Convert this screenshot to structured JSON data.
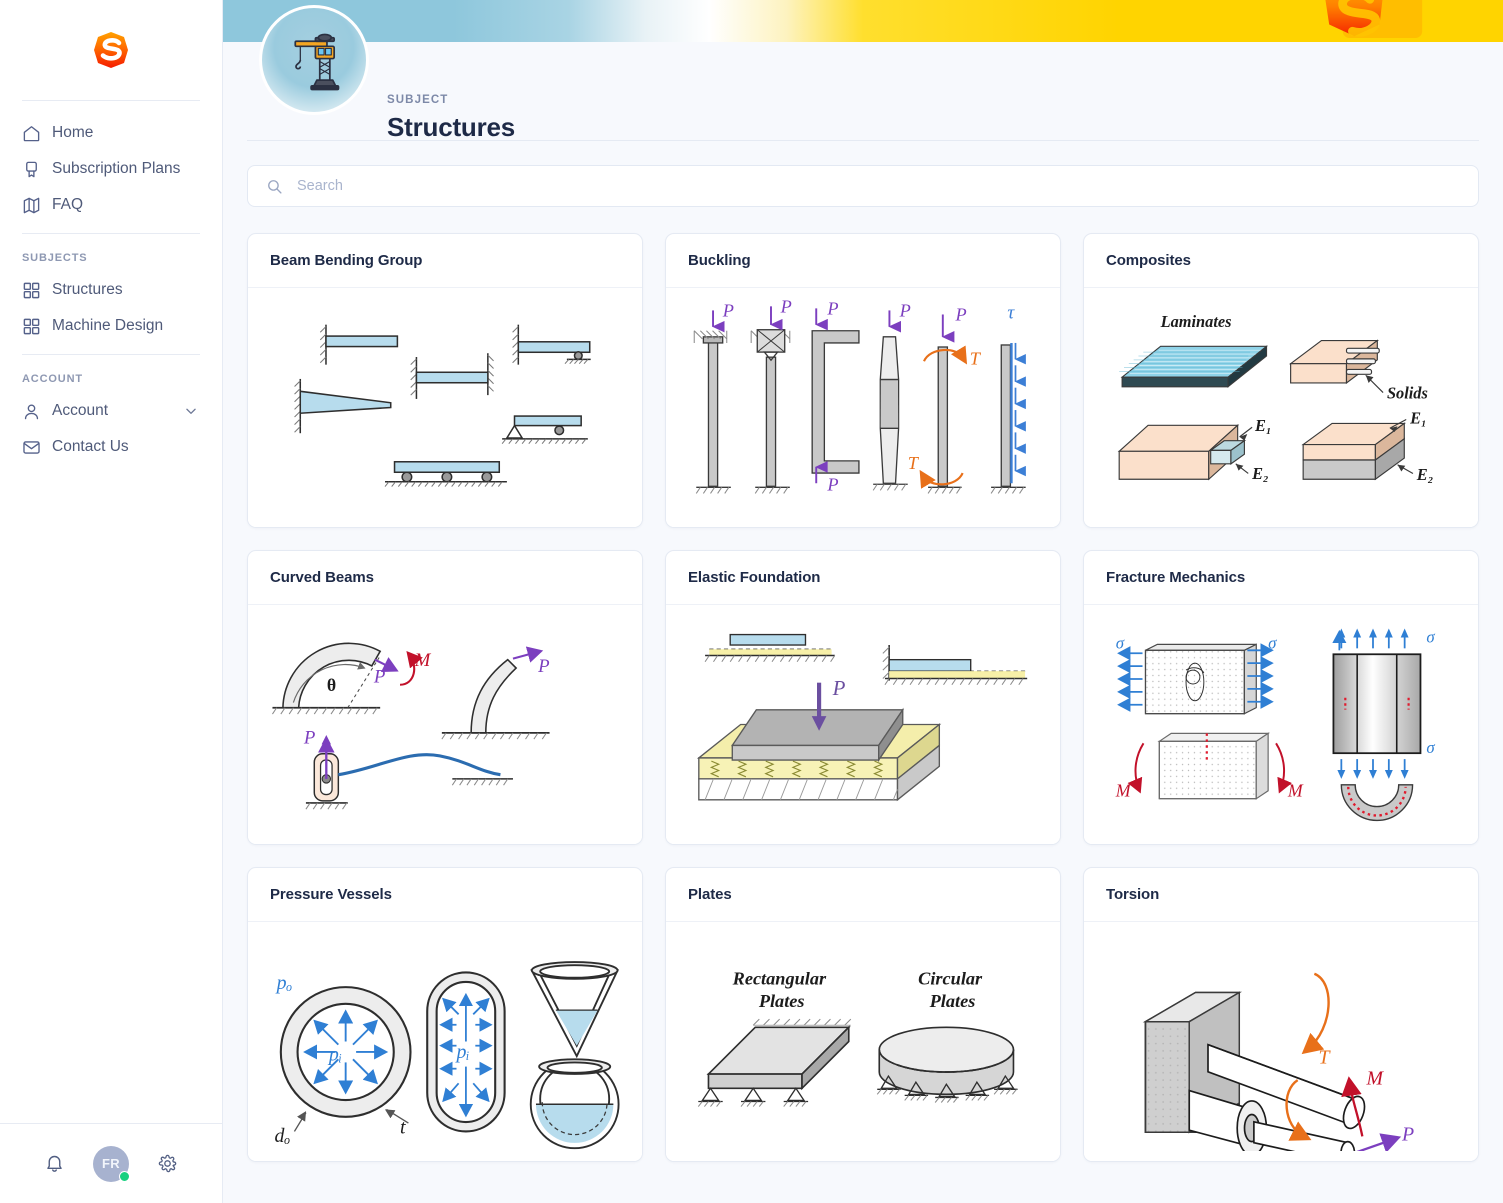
{
  "brand": {
    "logo_icon": "s-logo-icon",
    "accent": "#ff4b07",
    "accent2": "#ffa200"
  },
  "sidebar": {
    "primary": [
      {
        "label": "Home",
        "icon": "home-icon"
      },
      {
        "label": "Subscription Plans",
        "icon": "award-icon"
      },
      {
        "label": "FAQ",
        "icon": "map-icon"
      }
    ],
    "subjects_label": "SUBJECTS",
    "subjects": [
      {
        "label": "Structures",
        "icon": "grid-icon"
      },
      {
        "label": "Machine Design",
        "icon": "grid-icon"
      }
    ],
    "account_label": "ACCOUNT",
    "account": [
      {
        "label": "Account",
        "icon": "user-icon",
        "chevron": "chevron-down-icon"
      },
      {
        "label": "Contact Us",
        "icon": "mail-icon"
      }
    ],
    "footer": {
      "bell_icon": "bell-icon",
      "avatar_initials": "FR",
      "status_color": "#17d07f",
      "gear_icon": "gear-icon"
    }
  },
  "header": {
    "kicker": "SUBJECT",
    "title": "Structures",
    "badge_icon": "crane-icon",
    "banner_colors": {
      "left": "#8ec7dc",
      "right": "#ffd400"
    }
  },
  "search": {
    "placeholder": "Search",
    "value": "",
    "icon": "search-icon"
  },
  "cards": [
    {
      "title": "Beam Bending Group",
      "illustration": "beam-bending"
    },
    {
      "title": "Buckling",
      "illustration": "buckling",
      "labels": [
        "P",
        "P",
        "P",
        "P",
        "P",
        "P",
        "P",
        "T",
        "T",
        "τ"
      ]
    },
    {
      "title": "Composites",
      "illustration": "composites",
      "labels": [
        "Laminates",
        "Solids",
        "E₁",
        "E₂",
        "E₁",
        "E₂"
      ]
    },
    {
      "title": "Curved Beams",
      "illustration": "curved-beams",
      "labels": [
        "P",
        "M",
        "θ",
        "P",
        "P"
      ]
    },
    {
      "title": "Elastic Foundation",
      "illustration": "elastic-foundation",
      "labels": [
        "P"
      ]
    },
    {
      "title": "Fracture Mechanics",
      "illustration": "fracture-mechanics",
      "labels": [
        "σ",
        "σ",
        "σ",
        "σ",
        "M",
        "M"
      ]
    },
    {
      "title": "Pressure Vessels",
      "illustration": "pressure-vessels",
      "labels": [
        "pₒ",
        "pᵢ",
        "pᵢ",
        "dₒ",
        "t"
      ]
    },
    {
      "title": "Plates",
      "illustration": "plates",
      "labels": [
        "Rectangular Plates",
        "Circular Plates"
      ]
    },
    {
      "title": "Torsion",
      "illustration": "torsion",
      "labels": [
        "T",
        "M",
        "P"
      ]
    }
  ]
}
